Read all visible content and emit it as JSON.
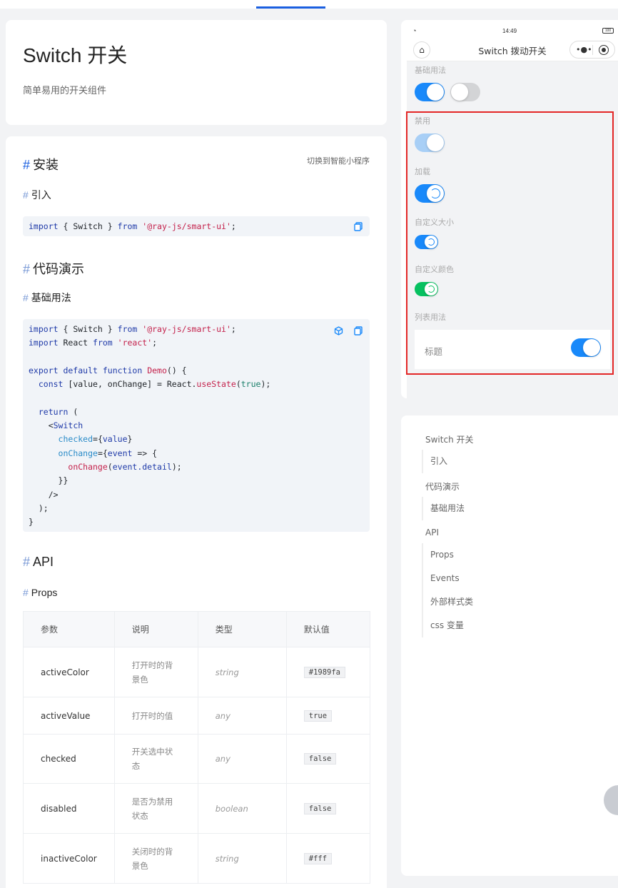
{
  "title_card": {
    "title": "Switch 开关",
    "subtitle": "简单易用的开关组件"
  },
  "main": {
    "install_heading": "安装",
    "switch_link": "切换到智能小程序",
    "import_heading": "引入",
    "import_code": {
      "kw_import": "import",
      "body": " { Switch } ",
      "kw_from": "from",
      "path": "'@ray-js/smart-ui'",
      "end": ";"
    },
    "demo_heading": "代码演示",
    "basic_heading": "基础用法",
    "api_heading": "API",
    "props_heading": "Props",
    "table": {
      "headers": [
        "参数",
        "说明",
        "类型",
        "默认值"
      ],
      "rows": [
        {
          "param": "activeColor",
          "desc": "打开时的背景色",
          "type": "string",
          "default": "#1989fa"
        },
        {
          "param": "activeValue",
          "desc": "打开时的值",
          "type": "any",
          "default": "true"
        },
        {
          "param": "checked",
          "desc": "开关选中状态",
          "type": "any",
          "default": "false"
        },
        {
          "param": "disabled",
          "desc": "是否为禁用状态",
          "type": "boolean",
          "default": "false"
        },
        {
          "param": "inactiveColor",
          "desc": "关闭时的背景色",
          "type": "string",
          "default": "#fff"
        }
      ]
    }
  },
  "phone": {
    "time": "14:49",
    "battery": "100",
    "nav_title": "Switch 拨动开关",
    "sections": {
      "basic": "基础用法",
      "disabled": "禁用",
      "loading": "加载",
      "custom_size": "自定义大小",
      "custom_color": "自定义颜色",
      "list": "列表用法"
    },
    "list_item_label": "标题"
  },
  "toc": {
    "items": [
      "Switch 开关",
      "引入",
      "代码演示",
      "基础用法",
      "API",
      "Props",
      "Events",
      "外部样式类",
      "css 变量"
    ]
  },
  "colors": {
    "accent": "#1989fa",
    "green": "#07c160",
    "red_highlight": "#e32626",
    "link_blue": "#1a5fe0"
  }
}
